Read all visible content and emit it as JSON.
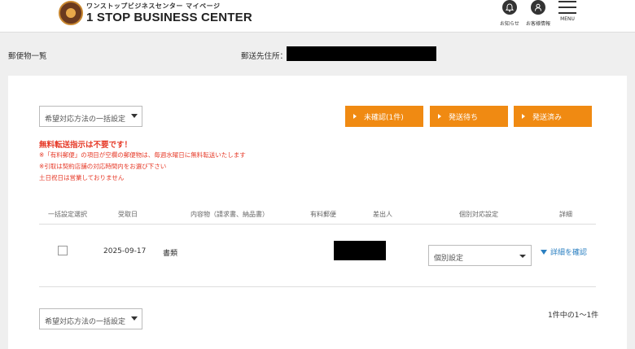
{
  "header": {
    "logo_sub": "ワンストップビジネスセンター マイページ",
    "logo_main": "1 STOP BUSINESS CENTER",
    "notifications_label": "お知らせ",
    "customer_info_label": "お客様情報",
    "menu_label": "MENU"
  },
  "page": {
    "title": "郵便物一覧",
    "address_label": "郵送先住所："
  },
  "bulk_setting": {
    "top_label": "希望対応方法の一括設定",
    "bottom_label": "希望対応方法の一括設定"
  },
  "filter_buttons": [
    {
      "label": "未確認(1件)"
    },
    {
      "label": "発送待ち"
    },
    {
      "label": "発送済み"
    }
  ],
  "notice": {
    "title": "無料転送指示は不要です！",
    "lines": [
      "※「有料郵便」の項目が空欄の郵便物は、毎週水曜日に無料転送いたします",
      "※引取は契約店舗の対応時間内をお選び下さい",
      "土日祝日は営業しておりません"
    ]
  },
  "table": {
    "columns": [
      "一括設定選択",
      "受取日",
      "内容物（請求書、納品書）",
      "有料郵便",
      "差出人",
      "個別対応設定",
      "詳細"
    ],
    "rows": [
      {
        "date": "2025-09-17",
        "contents": "書類",
        "paid_mail": "",
        "individual_setting": "個別設定",
        "detail_label": "詳細を確認"
      }
    ]
  },
  "pagination": {
    "count_text": "1件中の1〜1件"
  },
  "colors": {
    "accent_orange": "#f08a12",
    "notice_red": "#e63a28",
    "link_blue": "#2a7fc1"
  }
}
